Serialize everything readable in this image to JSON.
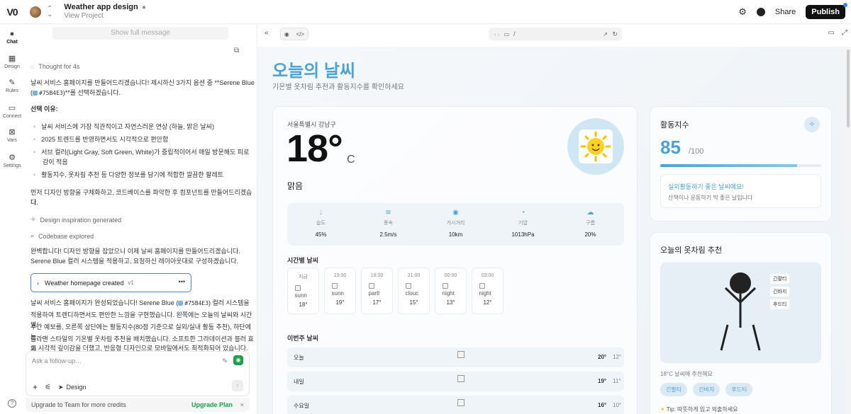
{
  "topbar": {
    "logo": "V0",
    "project_title": "Weather app design",
    "project_sub": "View Project",
    "share": "Share",
    "publish": "Publish"
  },
  "rail": [
    {
      "label": "Chat",
      "icon": "chat-icon"
    },
    {
      "label": "Design",
      "icon": "design-icon"
    },
    {
      "label": "Rules",
      "icon": "rules-icon"
    },
    {
      "label": "Connect",
      "icon": "connect-icon"
    },
    {
      "label": "Vars",
      "icon": "vars-icon"
    },
    {
      "label": "Settings",
      "icon": "settings-icon"
    }
  ],
  "chat": {
    "show_full": "Show full message",
    "thought": "Thought for 4s",
    "intro_1": "날씨 서비스 홈페이지를 만들어드리겠습니다! 제시하신 3가지 옵션 중 **Serene Blue",
    "intro_2_pre": "(",
    "intro_2_hex": "#75B4E3",
    "intro_2_post": ")**를 선택하겠습니다.",
    "reason_title": "선택 이유:",
    "reasons": [
      "날씨 서비스에 가장 직관적이고 자연스러운 연상 (하늘, 맑은 날씨)",
      "2025 트렌드를 반영하면서도 시각적으로 편안함",
      "서브 컬러(Light Gray, Soft Green, White)가 중립적이어서 매일 방문해도 피로",
      "감이 적음",
      "활동지수, 옷차림 추천 등 다양한 정보를 담기에 적합한 깔끔한 팔레트"
    ],
    "plan_1": "먼저 디자인 방향을 구체화하고, 코드베이스를 파악한 후 컴포넌트를 만들어드리겠습니",
    "plan_2": "다.",
    "design_gen": "Design inspiration generated",
    "codebase": "Codebase explored",
    "perfect_1": "완벽합니다! 디자인 방향을 잡았으니 이제 날씨 홈페이지를 만들어드리겠습니다.",
    "perfect_2": "Serene Blue 컬러 시스템을 적용하고, 요청하신 레이아웃대로 구성하겠습니다.",
    "created_label": "Weather homepage created",
    "created_ver": "v1",
    "done_1_pre": "날씨 서비스 홈페이지가 완성되었습니다! Serene Blue (",
    "done_1_hex": "#75B4E3",
    "done_1_post": ") 컬러 시스템을",
    "done_2": "적용하여 트렌디하면서도 편안한 느낌을 구현했습니다. 왼쪽에는 오늘의 날씨와 시간별/",
    "done_3": "주간 예보를, 오른쪽 상단에는 활동지수(80점 기준으로 실외/실내 활동 추천), 하단에는",
    "done_4": "졸라맨 스타일의 기온별 옷차림 추천을 배치했습니다. 소프트한 그라데이션과 블러 효과",
    "done_5": "로 시각적 깊이감을 더했고, 반응형 디자인으로 모바일에서도 최적화되어 있습니다.",
    "composer_placeholder": "Ask a follow-up…",
    "design_tool": "Design",
    "upgrade_text": "Upgrade to Team for more credits",
    "upgrade_plan": "Upgrade Plan"
  },
  "preview": {
    "url_path": "/"
  },
  "site": {
    "title": "오늘의 날씨",
    "subtitle": "기온별 옷차림 추천과 활동지수를 확인하세요",
    "location": "서울특별시 강남구",
    "temp": "18°",
    "unit": "C",
    "condition": "맑음",
    "stats": [
      {
        "name": "습도",
        "value": "45%",
        "icon": "droplet-icon"
      },
      {
        "name": "풍속",
        "value": "2.5m/s",
        "icon": "wind-icon"
      },
      {
        "name": "가시거리",
        "value": "10km",
        "icon": "eye-icon"
      },
      {
        "name": "기압",
        "value": "1013hPa",
        "icon": "gauge-icon"
      },
      {
        "name": "구름",
        "value": "20%",
        "icon": "cloud-icon"
      }
    ],
    "hourly_title": "시간별 날씨",
    "hourly": [
      {
        "time": "지금",
        "alt": "sunn",
        "temp": "18°"
      },
      {
        "time": "15:00",
        "alt": "sunn",
        "temp": "19°"
      },
      {
        "time": "18:00",
        "alt": "partl",
        "temp": "17°"
      },
      {
        "time": "21:00",
        "alt": "clouc",
        "temp": "15°"
      },
      {
        "time": "00:00",
        "alt": "night",
        "temp": "13°"
      },
      {
        "time": "03:00",
        "alt": "night",
        "temp": "12°"
      }
    ],
    "weekly_title": "이번주 날씨",
    "weekly": [
      {
        "day": "오늘",
        "hi": "20°",
        "lo": "12°"
      },
      {
        "day": "내일",
        "hi": "19°",
        "lo": "11°"
      },
      {
        "day": "수요일",
        "hi": "16°",
        "lo": "10°"
      }
    ],
    "activity": {
      "title": "활동지수",
      "score": "85",
      "max": "/100",
      "fill": 0.85,
      "msg_title": "실외활동하기 좋은 날씨예요!",
      "msg_sub": "산책이나 운동하기 딱 좋은 날입니다"
    },
    "outfit": {
      "title": "오늘의 옷차림 추천",
      "tags": [
        "긴팔티",
        "긴바지",
        "후드티"
      ],
      "caption": "18°C 날씨에 추천해요",
      "pills": [
        "긴팔티",
        "긴바지",
        "후드티"
      ],
      "tip": "Tip: 따뜻하게 입고 외출하세요"
    },
    "accent": "#4aa3d6"
  }
}
